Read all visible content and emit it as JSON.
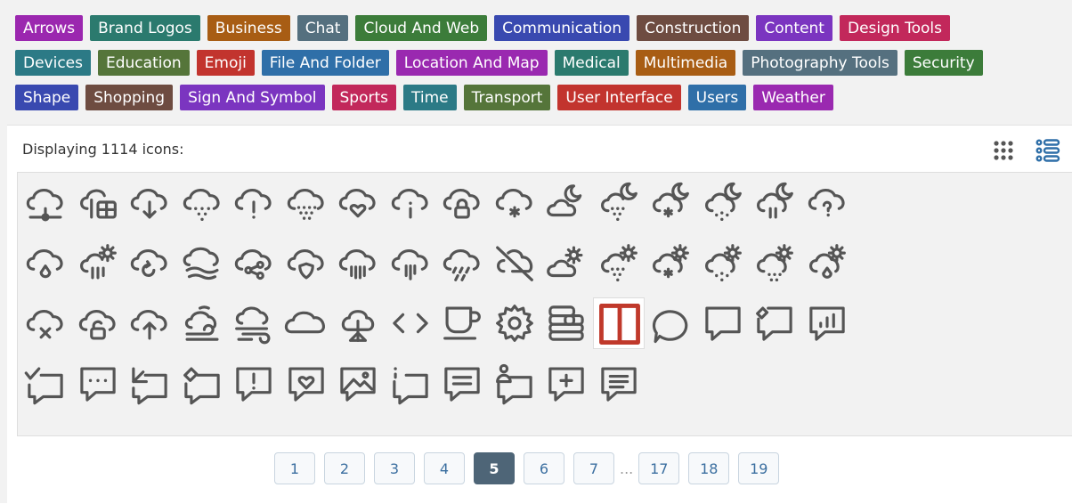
{
  "tags": [
    [
      {
        "label": "Arrows",
        "color": "#9b27af"
      },
      {
        "label": "Brand Logos",
        "color": "#2b7a6e"
      },
      {
        "label": "Business",
        "color": "#a85d14"
      },
      {
        "label": "Chat",
        "color": "#55707f"
      },
      {
        "label": "Cloud And Web",
        "color": "#3c7c3a"
      },
      {
        "label": "Communication",
        "color": "#3949b0"
      },
      {
        "label": "Construction",
        "color": "#6e4c41"
      },
      {
        "label": "Content",
        "color": "#7b35c0"
      },
      {
        "label": "Design Tools",
        "color": "#c2285b"
      }
    ],
    [
      {
        "label": "Devices",
        "color": "#2c7a86"
      },
      {
        "label": "Education",
        "color": "#55753a"
      },
      {
        "label": "Emoji",
        "color": "#c2342e"
      },
      {
        "label": "File And Folder",
        "color": "#2f6fa8"
      },
      {
        "label": "Location And Map",
        "color": "#9a29b0"
      },
      {
        "label": "Medical",
        "color": "#2b7a6e"
      },
      {
        "label": "Multimedia",
        "color": "#a85d14"
      },
      {
        "label": "Photography Tools",
        "color": "#55707f"
      },
      {
        "label": "Security",
        "color": "#3c7c3a"
      }
    ],
    [
      {
        "label": "Shape",
        "color": "#3949b0"
      },
      {
        "label": "Shopping",
        "color": "#6e4c41"
      },
      {
        "label": "Sign And Symbol",
        "color": "#7b35c0"
      },
      {
        "label": "Sports",
        "color": "#c2285b"
      },
      {
        "label": "Time",
        "color": "#2c7a86"
      },
      {
        "label": "Transport",
        "color": "#55753a"
      },
      {
        "label": "User Interface",
        "color": "#c2342e"
      },
      {
        "label": "Users",
        "color": "#2f6fa8"
      },
      {
        "label": "Weather",
        "color": "#9a29b0"
      }
    ]
  ],
  "status_text": "Displaying 1114 icons:",
  "view_icons": [
    "grid-view-icon",
    "list-view-icon"
  ],
  "icons": [
    [
      "cloud-network",
      "cloud-data",
      "cloud-download",
      "cloud-drizzle",
      "cloud-exclamation",
      "cloud-hail",
      "cloud-heart",
      "cloud-info",
      "cloud-lock",
      "cloud-snow",
      "cloud-moon",
      "cloud-moon-hail",
      "cloud-moon-snow",
      "cloud-moon-rain",
      "cloud-moon-showers",
      "cloud-question"
    ],
    [
      "cloud-raindrop",
      "cloud-sun-showers",
      "cloud-refresh",
      "cloud-fog",
      "cloud-share",
      "cloud-shield",
      "cloud-showers-heavy",
      "cloud-showers",
      "cloud-sleet",
      "cloud-off",
      "cloud-sun",
      "cloud-sun-hail",
      "cloud-sun-snow",
      "cloud-sun-rain",
      "cloud-sun-drizzle",
      "cloud-sun-raindrop"
    ],
    [
      "cloud-x",
      "cloud-unlock",
      "cloud-upload",
      "cloud-wind-fog",
      "cloud-wind",
      "cloud-outline",
      "tree-cloud",
      "code-brackets",
      "coffee-cup",
      "settings-cog",
      "coins-stack",
      "columns-layout",
      "chat-bubble-round",
      "chat-bubble-square",
      "chat-bubble-edit",
      "chat-chart"
    ],
    [
      "chat-check",
      "chat-dots",
      "chat-arrow",
      "chat-pen",
      "chat-exclamation",
      "chat-heart",
      "chat-image",
      "chat-info",
      "chat-text",
      "chat-person",
      "chat-plus",
      "chat-lines"
    ]
  ],
  "selected_icon": "columns-layout",
  "pagination": {
    "pages": [
      "1",
      "2",
      "3",
      "4",
      "5",
      "6",
      "7",
      "...",
      "17",
      "18",
      "19"
    ],
    "current": "5"
  },
  "colors": {
    "icon_stroke": "#555555",
    "selected_icon": "#c0392b",
    "page_active": "#4e6577"
  }
}
